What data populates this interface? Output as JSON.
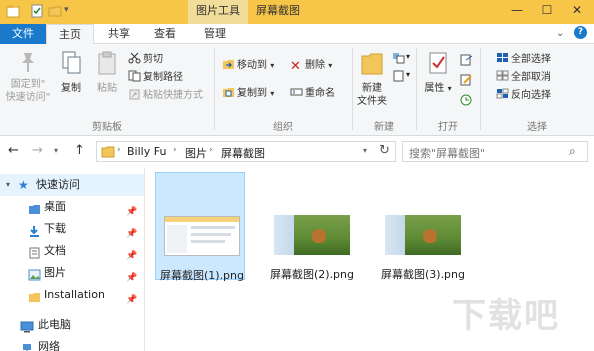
{
  "titlebar": {
    "context_tab": "图片工具",
    "title": "屏幕截图",
    "minimize": "—",
    "maximize": "☐",
    "close": "✕"
  },
  "tabs": {
    "file": "文件",
    "home": "主页",
    "share": "共享",
    "view": "查看",
    "manage": "管理"
  },
  "ribbon": {
    "clipboard": {
      "pin_quick_access": "固定到\"\n快速访问\"",
      "pin_line1": "固定到\"",
      "pin_line2": "快速访问\"",
      "copy": "复制",
      "paste": "粘贴",
      "cut": "剪切",
      "copy_path": "复制路径",
      "paste_shortcut": "粘贴快捷方式",
      "group_label": "剪贴板"
    },
    "organize": {
      "move_to": "移动到",
      "delete": "删除",
      "copy_to": "复制到",
      "rename": "重命名",
      "group_label": "组织"
    },
    "new": {
      "new_folder_line1": "新建",
      "new_folder_line2": "文件夹",
      "group_label": "新建"
    },
    "open": {
      "properties": "属性",
      "group_label": "打开"
    },
    "select": {
      "select_all": "全部选择",
      "select_none": "全部取消",
      "invert": "反向选择",
      "group_label": "选择"
    }
  },
  "address": {
    "crumbs": [
      "Billy Fu",
      "图片",
      "屏幕截图"
    ],
    "search_placeholder": "搜索\"屏幕截图\""
  },
  "nav": {
    "quick_access": "快速访问",
    "items": [
      {
        "label": "桌面",
        "pinned": true
      },
      {
        "label": "下载",
        "pinned": true
      },
      {
        "label": "文档",
        "pinned": true
      },
      {
        "label": "图片",
        "pinned": true
      },
      {
        "label": "Installation",
        "pinned": true
      }
    ],
    "this_pc": "此电脑",
    "network": "网络"
  },
  "files": [
    {
      "name": "屏幕截图(1).png",
      "selected": true,
      "kind": "window"
    },
    {
      "name": "屏幕截图(2).png",
      "selected": false,
      "kind": "nature"
    },
    {
      "name": "屏幕截图(3).png",
      "selected": false,
      "kind": "nature"
    }
  ],
  "watermark": "下载吧",
  "colors": {
    "titlebar": "#f7c648",
    "file_tab": "#1979ca",
    "selected_bg": "#cce8ff",
    "selected_border": "#99d1ff",
    "folder": "#f4c65a"
  }
}
